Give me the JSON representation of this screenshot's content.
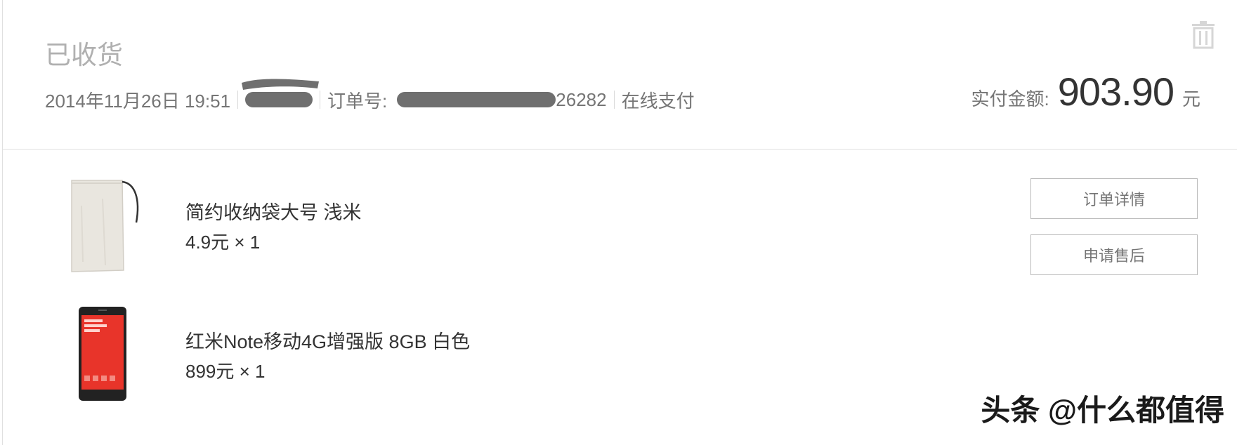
{
  "order": {
    "status": "已收货",
    "datetime": "2014年11月26日 19:51",
    "order_no_label": "订单号:",
    "order_no_tail": "26282",
    "payment_method": "在线支付",
    "amount_label": "实付金额:",
    "amount_value": "903.90",
    "amount_unit": "元"
  },
  "items": [
    {
      "name": "简约收纳袋大号 浅米",
      "price": "4.9元 × 1",
      "icon": "storage-bag-image"
    },
    {
      "name": "红米Note移动4G增强版 8GB 白色",
      "price": "899元 × 1",
      "icon": "phone-image"
    }
  ],
  "actions": {
    "order_detail": "订单详情",
    "after_sale": "申请售后"
  },
  "watermark": "头条 @什么都值得",
  "colors": {
    "status_gray": "#b0b0b0",
    "text_gray": "#757575",
    "text_dark": "#333333",
    "border": "#e0e0e0",
    "phone_red": "#e8342a"
  }
}
